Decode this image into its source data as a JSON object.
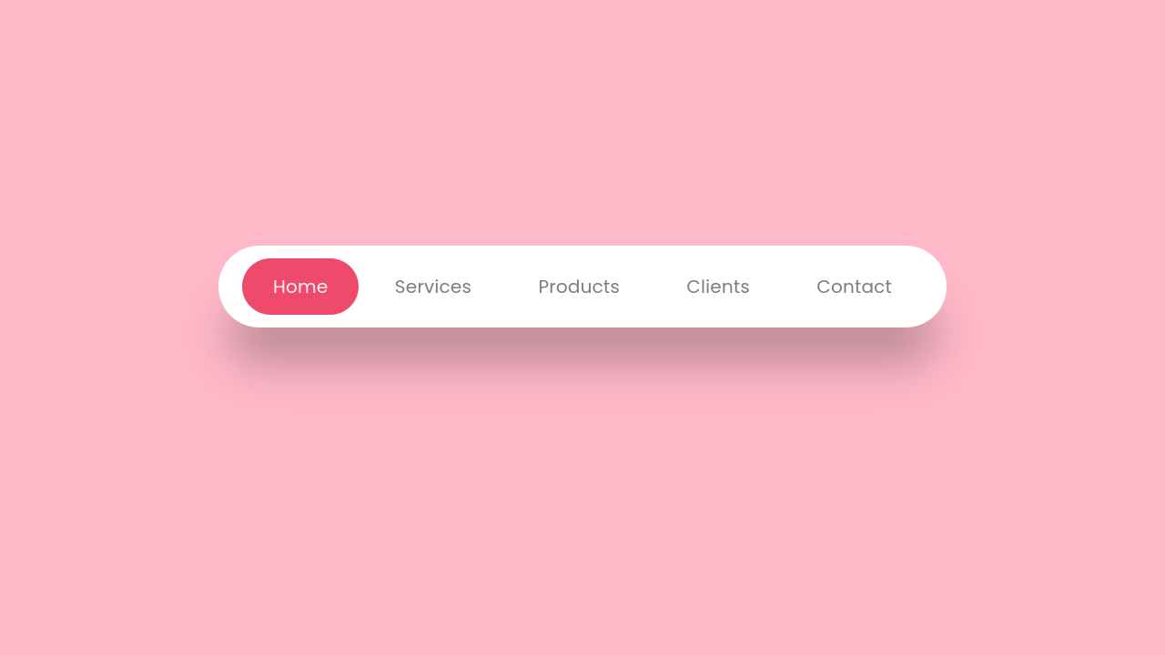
{
  "nav": {
    "items": [
      {
        "label": "Home",
        "active": true
      },
      {
        "label": "Services",
        "active": false
      },
      {
        "label": "Products",
        "active": false
      },
      {
        "label": "Clients",
        "active": false
      },
      {
        "label": "Contact",
        "active": false
      }
    ]
  },
  "colors": {
    "background": "#ffb9c9",
    "nav_bg": "#ffffff",
    "active_bg": "#ef4a6b",
    "active_text": "#fdeef1",
    "inactive_text": "#7d7d7d"
  }
}
